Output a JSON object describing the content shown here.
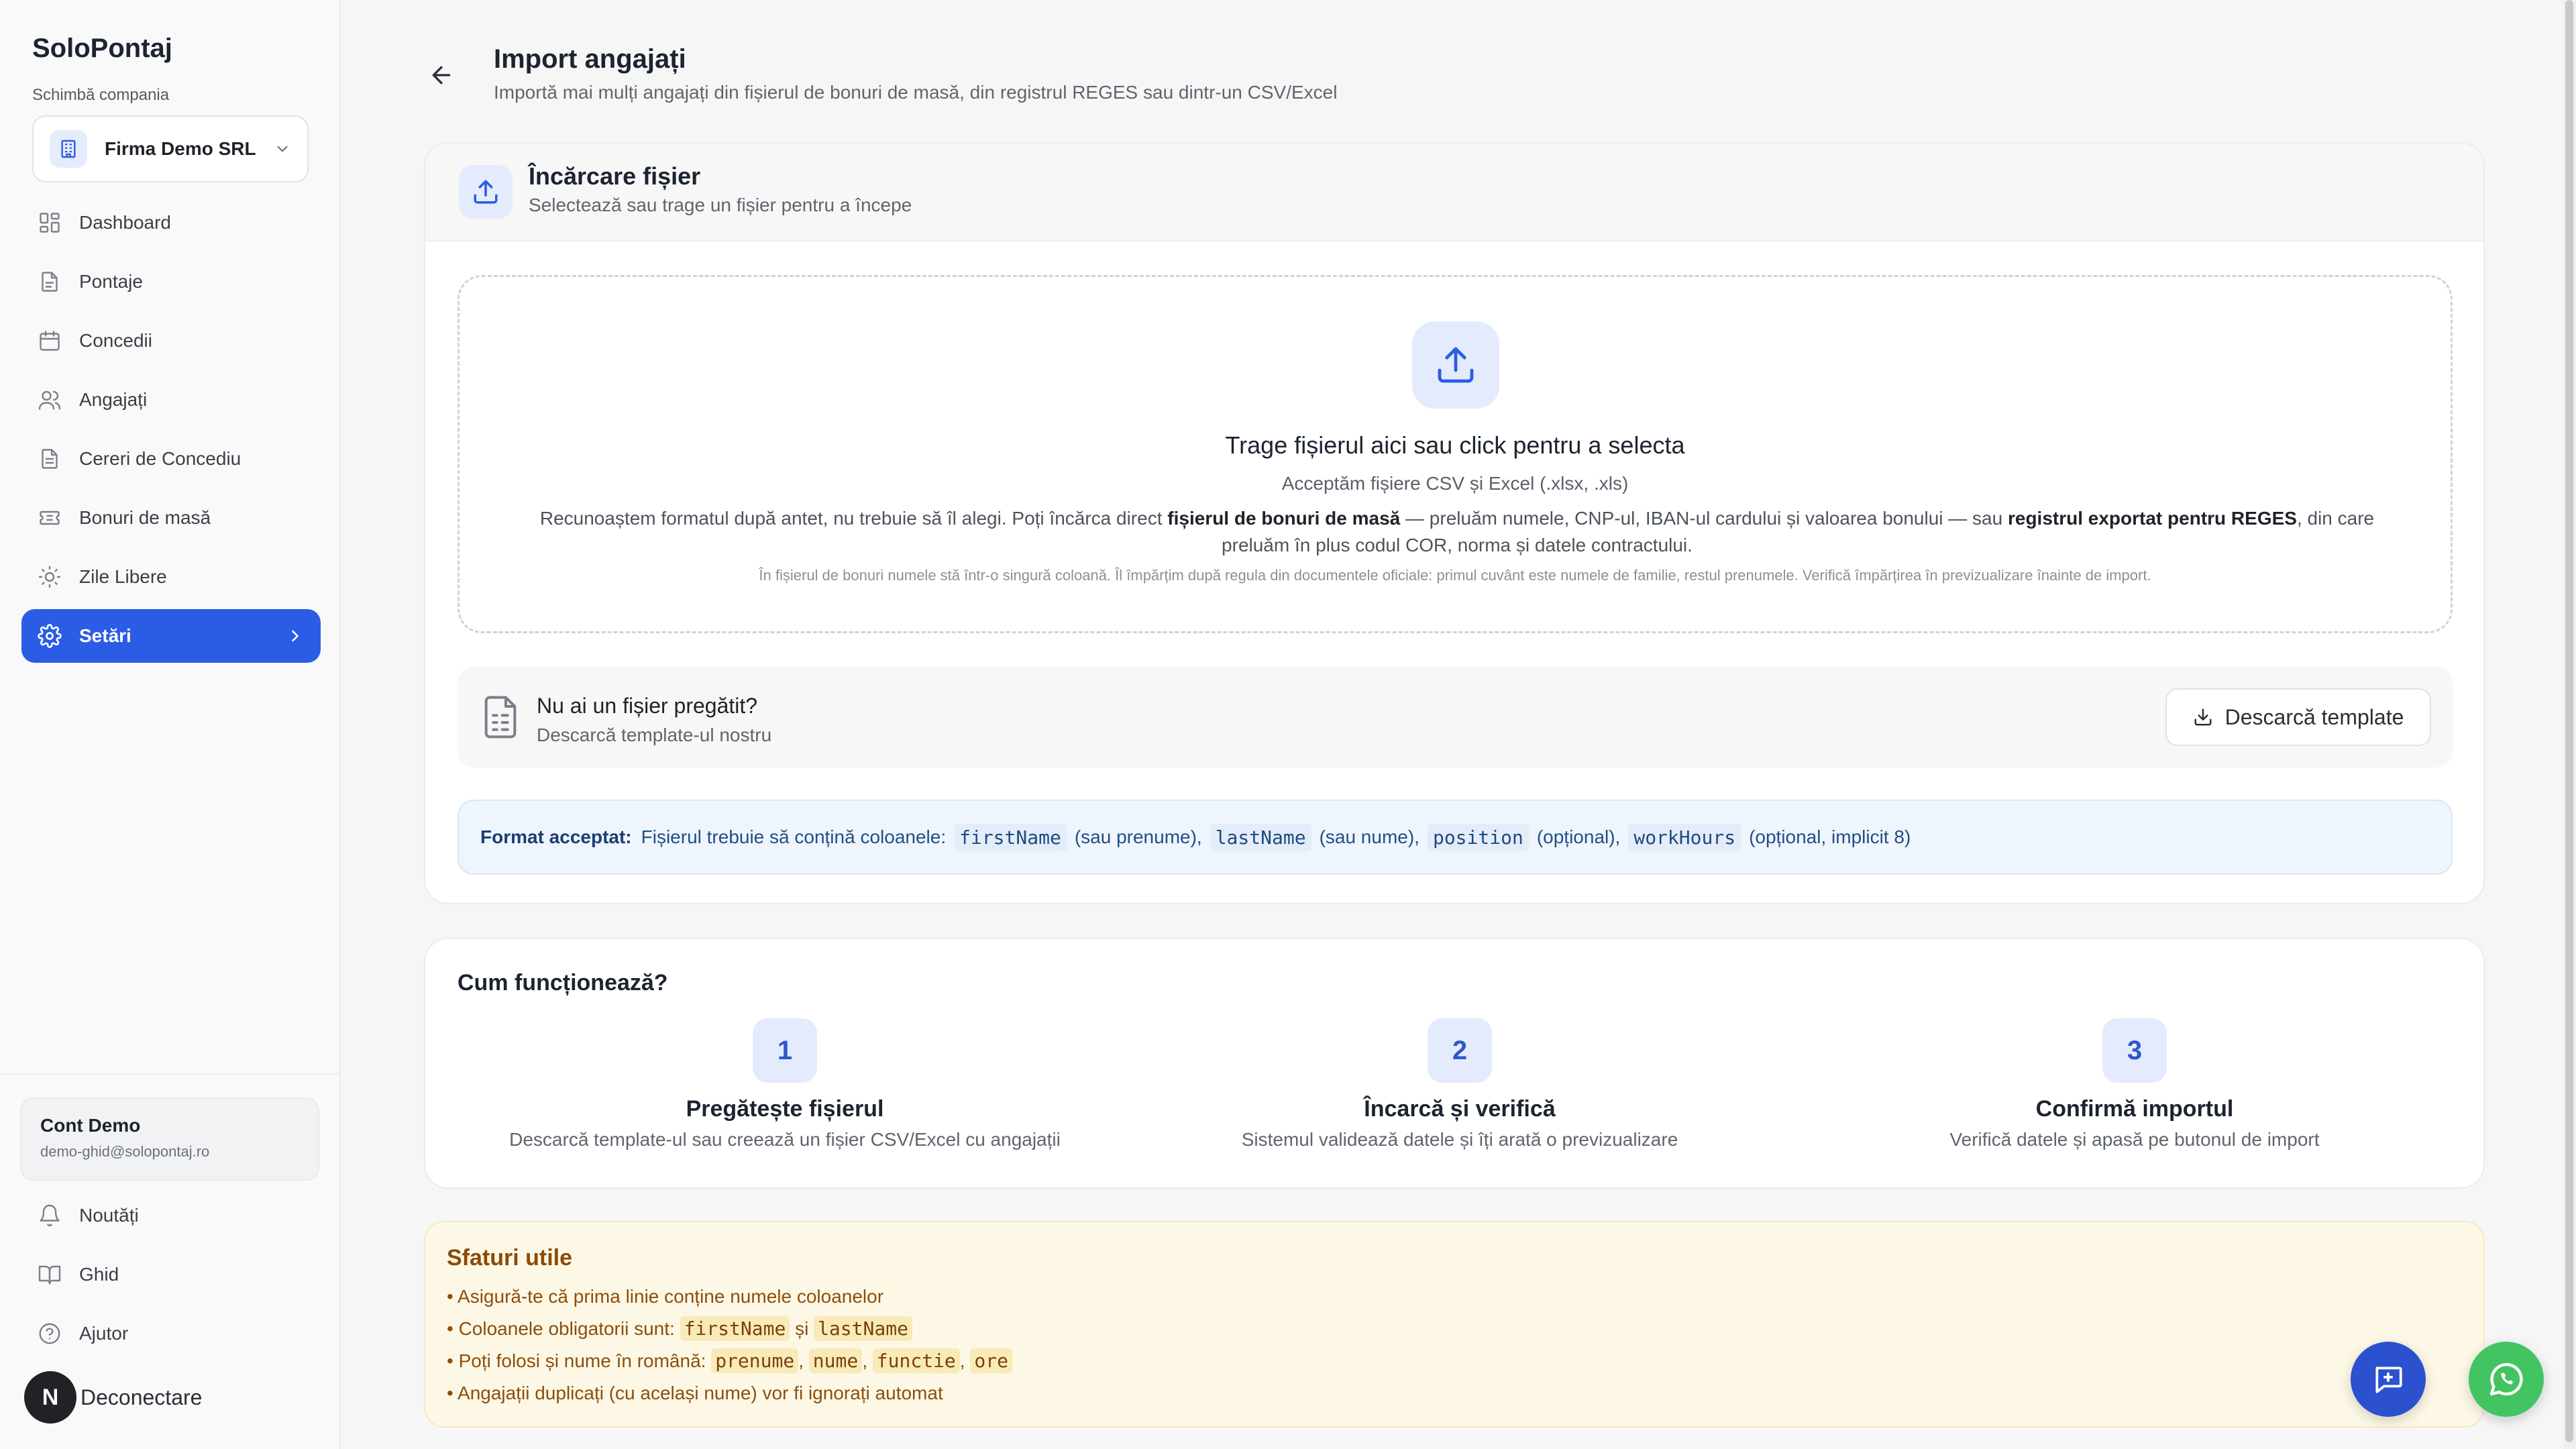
{
  "sidebar": {
    "brand": "SoloPontaj",
    "company_label": "Schimbă compania",
    "company_name": "Firma Demo SRL",
    "items": [
      {
        "label": "Dashboard"
      },
      {
        "label": "Pontaje"
      },
      {
        "label": "Concedii"
      },
      {
        "label": "Angajați"
      },
      {
        "label": "Cereri de Concediu"
      },
      {
        "label": "Bonuri de masă"
      },
      {
        "label": "Zile Libere"
      },
      {
        "label": "Setări"
      }
    ],
    "account": {
      "name": "Cont Demo",
      "email": "demo-ghid@solopontaj.ro"
    },
    "footer_items": [
      {
        "label": "Noutăți"
      },
      {
        "label": "Ghid"
      },
      {
        "label": "Ajutor"
      }
    ],
    "logout": {
      "avatar_letter": "N",
      "label": "Deconectare"
    }
  },
  "header": {
    "title": "Import angajați",
    "subtitle": "Importă mai mulți angajați din fișierul de bonuri de masă, din registrul REGES sau dintr-un CSV/Excel"
  },
  "upload": {
    "title": "Încărcare fișier",
    "subtitle": "Selectează sau trage un fișier pentru a începe",
    "dropzone": {
      "title": "Trage fișierul aici sau click pentru a selecta",
      "accept": "Acceptăm fișiere CSV și Excel (.xlsx, .xls)",
      "desc_1": "Recunoaștem formatul după antet, nu trebuie să îl alegi. Poți încărca direct ",
      "desc_bold_1": "fișierul de bonuri de masă",
      "desc_2": " — preluăm numele, CNP-ul, IBAN-ul cardului și valoarea bonului — sau ",
      "desc_bold_2": "registrul exportat pentru REGES",
      "desc_3": ", din care preluăm în plus codul COR, norma și datele contractului.",
      "note": "În fișierul de bonuri numele stă într-o singură coloană. Îl împărțim după regula din documentele oficiale: primul cuvânt este numele de familie, restul prenumele. Verifică împărțirea în previzualizare înainte de import."
    },
    "template": {
      "title": "Nu ai un fișier pregătit?",
      "subtitle": "Descarcă template-ul nostru",
      "button": "Descarcă template"
    },
    "format": {
      "label": "Format acceptat:",
      "intro": "Fișierul trebuie să conțină coloanele:",
      "col1": "firstName",
      "col1_note": "(sau prenume),",
      "col2": "lastName",
      "col2_note": "(sau nume),",
      "col3": "position",
      "col3_note": "(opțional),",
      "col4": "workHours",
      "col4_note": "(opțional, implicit 8)"
    }
  },
  "how": {
    "title": "Cum funcționează?",
    "steps": [
      {
        "num": "1",
        "title": "Pregătește fișierul",
        "subtitle": "Descarcă template-ul sau creează un fișier CSV/Excel cu angajații"
      },
      {
        "num": "2",
        "title": "Încarcă și verifică",
        "subtitle": "Sistemul validează datele și îți arată o previzualizare"
      },
      {
        "num": "3",
        "title": "Confirmă importul",
        "subtitle": "Verifică datele și apasă pe butonul de import"
      }
    ]
  },
  "tips": {
    "title": "Sfaturi utile",
    "tip1": "• Asigură-te că prima linie conține numele coloanelor",
    "tip2_pre": "• Coloanele obligatorii sunt: ",
    "tip2_c1": "firstName",
    "tip2_mid": " și ",
    "tip2_c2": "lastName",
    "tip3_pre": "• Poți folosi și nume în română: ",
    "tip3_c1": "prenume",
    "tip3_c2": "nume",
    "tip3_c3": "functie",
    "tip3_c4": "ore",
    "tip3_sep": ", ",
    "tip4": "• Angajații duplicați (cu același nume) vor fi ignorați automat"
  },
  "colors": {
    "accent": "#2b5ce6",
    "whatsapp": "#42c462",
    "chat": "#2b51cf",
    "tips_text": "#8d4e0a",
    "format_text": "#234d86"
  },
  "icons": {
    "back": "arrow-left-icon",
    "upload": "upload-icon",
    "file": "file-spreadsheet-icon",
    "download": "download-icon",
    "chat": "chat-icon",
    "whatsapp": "whatsapp-icon"
  }
}
